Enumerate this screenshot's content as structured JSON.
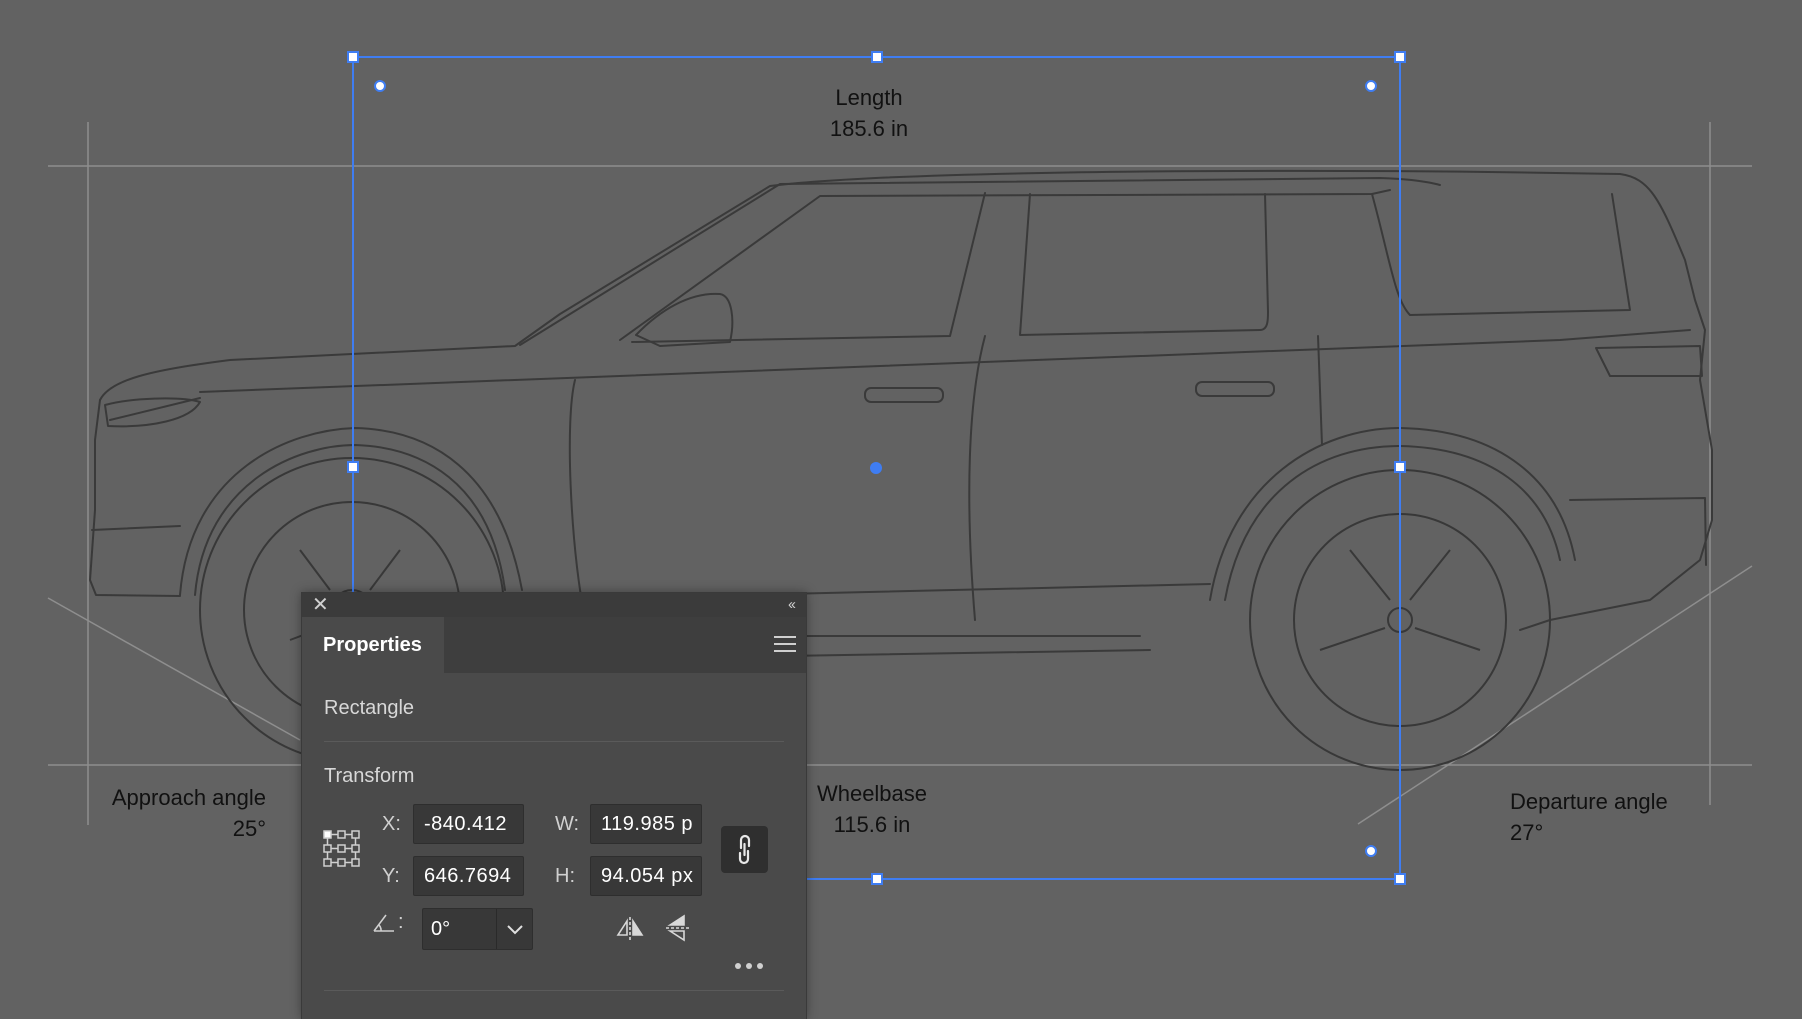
{
  "dimensions": {
    "length": {
      "label": "Length",
      "value": "185.6 in"
    },
    "wheelbase": {
      "label": "Wheelbase",
      "value": "115.6 in"
    },
    "approach": {
      "label": "Approach angle",
      "value": "25°"
    },
    "departure": {
      "label": "Departure angle",
      "value": "27°"
    }
  },
  "colors": {
    "background": "#626262",
    "selection": "#3f7df2",
    "line_art": "#3c3c3c",
    "guide": "#8b8b8b"
  },
  "panel": {
    "close_glyph": "✕",
    "collapse_glyph": "‹‹",
    "tab": "Properties",
    "object_type": "Rectangle",
    "section": "Transform",
    "x_label": "X:",
    "x_value": "-840.412",
    "y_label": "Y:",
    "y_value": "646.7694",
    "w_label": "W:",
    "w_value": "119.985 p",
    "h_label": "H:",
    "h_value": "94.054 px",
    "angle_label": ":",
    "angle_value": "0°",
    "icons": {
      "close": "close-icon",
      "collapse": "collapse-icon",
      "menu": "hamburger-menu-icon",
      "reference_point": "reference-point-grid-icon",
      "constrain": "link-chain-icon",
      "angle": "angle-icon",
      "dropdown": "chevron-down-icon",
      "flip_horizontal": "flip-horizontal-icon",
      "flip_vertical": "flip-vertical-icon",
      "more": "more-options-icon"
    }
  }
}
